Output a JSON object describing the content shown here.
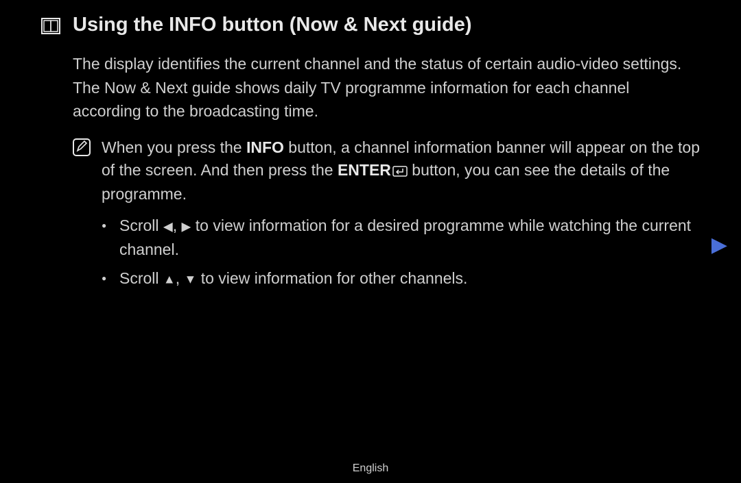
{
  "title": "Using the INFO button (Now & Next guide)",
  "paragraph1": "The display identifies the current channel and the status of certain audio-video settings.",
  "paragraph2": "The Now & Next guide shows daily TV programme information for each channel according to the broadcasting time.",
  "note": {
    "part1": "When you press the ",
    "bold1": "INFO",
    "part2": " button, a channel information banner will appear on the top of the screen. And then press the ",
    "bold2": "ENTER",
    "part3": " button, you can see the details of the programme."
  },
  "bullets": {
    "b1_pre": "Scroll ",
    "b1_post": " to view information for a desired programme while watching the current channel.",
    "b2_pre": "Scroll ",
    "b2_post": " to view information for other channels."
  },
  "arrows": {
    "left": "◀",
    "right": "▶",
    "up": "▲",
    "down": "▼",
    "comma": ", "
  },
  "footer": "English"
}
